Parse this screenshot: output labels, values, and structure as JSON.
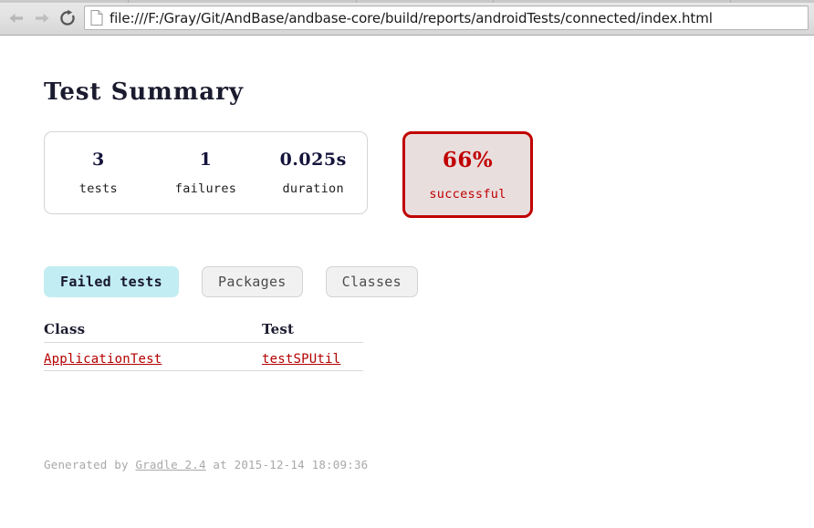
{
  "browser": {
    "back_icon": "arrow-left-icon",
    "forward_icon": "arrow-right-icon",
    "reload_icon": "reload-icon",
    "page_icon": "document-icon",
    "url": "file:///F:/Gray/Git/AndBase/andbase-core/build/reports/androidTests/connected/index.html"
  },
  "report": {
    "title": "Test Summary",
    "summary": [
      {
        "value": "3",
        "label": "tests"
      },
      {
        "value": "1",
        "label": "failures"
      },
      {
        "value": "0.025s",
        "label": "duration"
      }
    ],
    "rate": {
      "value": "66%",
      "label": "successful",
      "border_color": "#c00000",
      "background_color": "#e9dede",
      "text_color": "#c00000"
    },
    "tabs": [
      {
        "label": "Failed tests",
        "active": true
      },
      {
        "label": "Packages",
        "active": false
      },
      {
        "label": "Classes",
        "active": false
      }
    ],
    "table": {
      "headers": {
        "class": "Class",
        "test": "Test"
      },
      "rows": [
        {
          "class": "ApplicationTest",
          "test": "testSPUtil"
        }
      ]
    },
    "footer": {
      "prefix": "Generated by ",
      "link": "Gradle 2.4",
      "suffix": " at 2015-12-14 18:09:36"
    },
    "accent_active_tab": "#c2edf2",
    "link_color": "#b40000"
  }
}
